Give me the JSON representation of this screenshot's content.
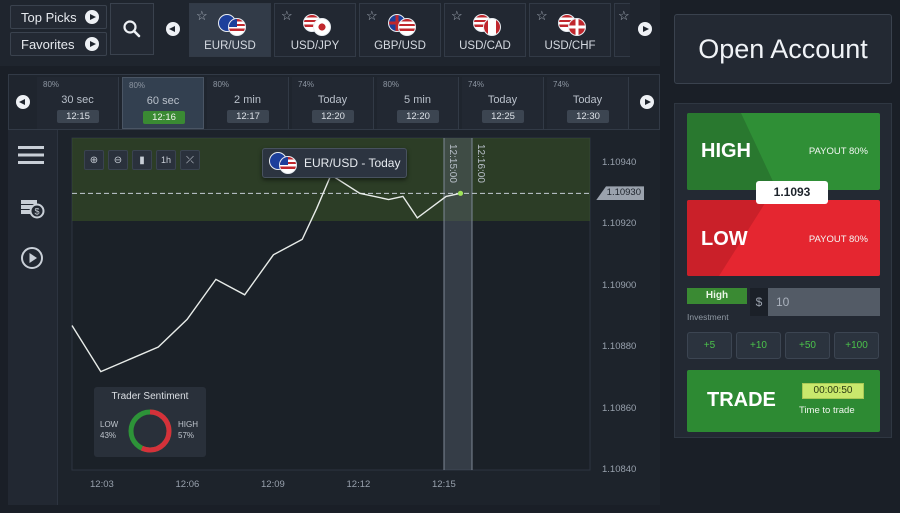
{
  "top_left": {
    "top_picks": "Top Picks",
    "favorites": "Favorites"
  },
  "assets": [
    {
      "name": "EUR/USD",
      "active": true
    },
    {
      "name": "USD/JPY",
      "active": false
    },
    {
      "name": "GBP/USD",
      "active": false
    },
    {
      "name": "USD/CAD",
      "active": false
    },
    {
      "name": "USD/CHF",
      "active": false
    }
  ],
  "expiry_options": [
    {
      "payout": "80%",
      "duration": "30 sec",
      "time": "12:15",
      "active": false
    },
    {
      "payout": "80%",
      "duration": "60 sec",
      "time": "12:16",
      "active": true
    },
    {
      "payout": "80%",
      "duration": "2 min",
      "time": "12:17",
      "active": false
    },
    {
      "payout": "74%",
      "duration": "Today",
      "time": "12:20",
      "active": false
    },
    {
      "payout": "80%",
      "duration": "5 min",
      "time": "12:20",
      "active": false
    },
    {
      "payout": "74%",
      "duration": "Today",
      "time": "12:25",
      "active": false
    },
    {
      "payout": "74%",
      "duration": "Today",
      "time": "12:30",
      "active": false
    }
  ],
  "chart": {
    "asset_label": "EUR/USD - Today",
    "current_price_tag": "1.10930",
    "expiry_marker_1": "12:15:00",
    "expiry_marker_2": "12:16:00",
    "sentiment": {
      "title": "Trader Sentiment",
      "low_label": "LOW",
      "low_pct": "43%",
      "high_label": "HIGH",
      "high_pct": "57%",
      "low_value": 43,
      "high_value": 57
    }
  },
  "chart_data": {
    "type": "line",
    "title": "EUR/USD - Today",
    "xlabel": "",
    "ylabel": "",
    "x_ticks": [
      "12:03",
      "12:06",
      "12:09",
      "12:12",
      "12:15"
    ],
    "y_ticks": [
      "1.10940",
      "1.10920",
      "1.10900",
      "1.10880",
      "1.10860",
      "1.10840"
    ],
    "ylim": [
      1.1084,
      1.10948
    ],
    "xlim": [
      12.0,
      12.18
    ],
    "current_price": 1.1093,
    "series": [
      {
        "x": [
          12.0,
          12.01,
          12.02,
          12.03,
          12.04,
          12.05,
          12.06,
          12.07,
          12.08,
          12.085,
          12.09,
          12.1,
          12.11,
          12.115,
          12.12,
          12.13,
          12.135
        ],
        "y": [
          1.10887,
          1.10872,
          1.10876,
          1.1088,
          1.10889,
          1.10902,
          1.10897,
          1.1091,
          1.10915,
          1.10925,
          1.10936,
          1.1093,
          1.10928,
          1.10929,
          1.10922,
          1.10929,
          1.1093
        ]
      }
    ],
    "grid": false
  },
  "panel": {
    "open_account": "Open Account",
    "high_label": "HIGH",
    "high_payout": "PAYOUT 80%",
    "low_label": "LOW",
    "low_payout": "PAYOUT 80%",
    "current_price": "1.1093",
    "mode": "High",
    "investment_label": "Investment",
    "currency": "$",
    "amount": "10",
    "quick_amounts": [
      "+5",
      "+10",
      "+50",
      "+100"
    ],
    "trade": "TRADE",
    "countdown": "00:00:50",
    "countdown_label": "Time to trade"
  },
  "colors": {
    "high": "#2f8f36",
    "low": "#e52630",
    "accent": "#3a8a33",
    "chart_line": "#e8ece9"
  }
}
